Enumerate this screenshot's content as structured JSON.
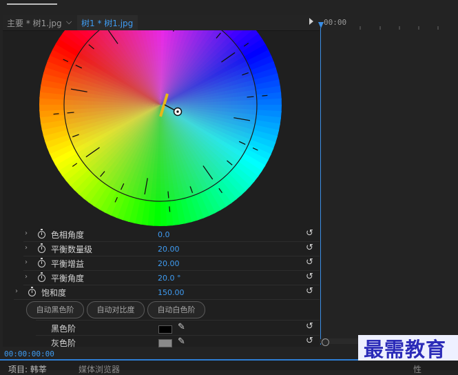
{
  "tabs": {
    "master": "主要 * 树1.jpg",
    "clip": "树1 * 树1.jpg"
  },
  "timeline": {
    "timecode_top": "00:00"
  },
  "colors": {
    "accent_blue": "#3f9cf2",
    "hue_indicator": "#e8b818"
  },
  "params": [
    {
      "label": "色相角度",
      "value": "0.0"
    },
    {
      "label": "平衡数量级",
      "value": "20.00"
    },
    {
      "label": "平衡增益",
      "value": "20.00"
    },
    {
      "label": "平衡角度",
      "value": "20.0 °"
    },
    {
      "label": "饱和度",
      "value": "150.00"
    }
  ],
  "buttons": {
    "auto_black": "自动黑色阶",
    "auto_contrast": "自动对比度",
    "auto_white": "自动白色阶"
  },
  "levels": {
    "black": "黑色阶",
    "gray": "灰色阶"
  },
  "status": {
    "timecode_bottom": "00:00:00:00"
  },
  "bottom_tabs": {
    "t1": "项目: 韩莘",
    "t2": "媒体浏览器",
    "t3": "性"
  },
  "watermark": "最需教育"
}
